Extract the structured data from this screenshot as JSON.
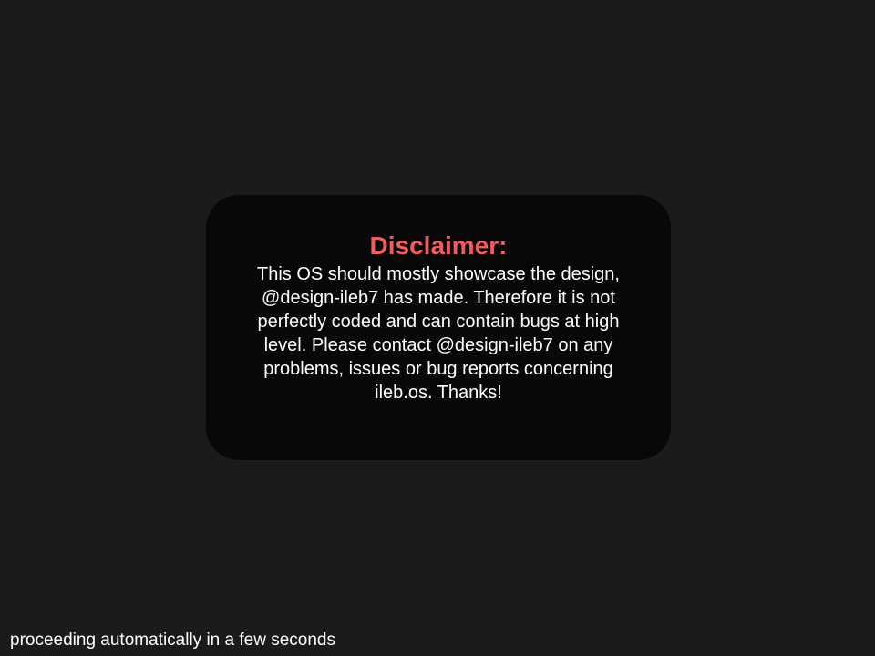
{
  "dialog": {
    "title": "Disclaimer:",
    "message": "This OS should mostly showcase the design, @design-ileb7 has made. Therefore it is not perfectly coded and can contain bugs at high level. Please contact @design-ileb7 on any problems, issues or bug reports concerning ileb.os. Thanks!"
  },
  "footer": {
    "status": "proceeding automatically in a few seconds"
  },
  "colors": {
    "background": "#1b1b1b",
    "dialog_background": "#080808",
    "title": "#f25c5c",
    "text": "#ffffff"
  }
}
